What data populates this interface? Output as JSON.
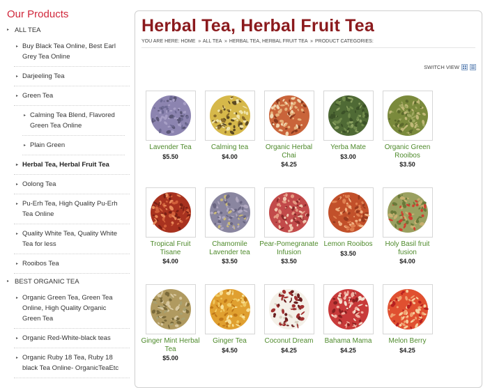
{
  "sidebar": {
    "title": "Our Products",
    "categories": [
      {
        "label": "ALL TEA",
        "level": "top"
      },
      {
        "label": "Buy Black Tea Online, Best Earl Grey Tea Online",
        "level": "l1"
      },
      {
        "label": "Darjeeling Tea",
        "level": "l1"
      },
      {
        "label": "Green Tea",
        "level": "l1"
      },
      {
        "label": "Calming Tea Blend, Flavored Green Tea Online",
        "level": "l2"
      },
      {
        "label": "Plain Green",
        "level": "l2"
      },
      {
        "label": "Herbal Tea, Herbal Fruit Tea",
        "level": "l1",
        "active": true
      },
      {
        "label": "Oolong Tea",
        "level": "l1"
      },
      {
        "label": "Pu-Erh Tea, High Quality Pu-Erh Tea Online",
        "level": "l1"
      },
      {
        "label": "Quality White Tea, Quality White Tea for less",
        "level": "l1"
      },
      {
        "label": "Rooibos Tea",
        "level": "l1"
      },
      {
        "label": "BEST ORGANIC TEA",
        "level": "top"
      },
      {
        "label": "Organic Green Tea, Green Tea Online, High Quality Organic Green Tea",
        "level": "l1"
      },
      {
        "label": "Organic Red-White-black teas",
        "level": "l1"
      },
      {
        "label": "Organic Ruby 18 Tea, Ruby 18 black Tea Online- OrganicTeaEtc",
        "level": "l1"
      }
    ]
  },
  "main": {
    "title": "Herbal Tea, Herbal Fruit Tea",
    "breadcrumb": {
      "prefix": "YOU ARE HERE:",
      "items": [
        "HOME",
        "ALL TEA",
        "HERBAL TEA, HERBAL FRUIT TEA",
        "PRODUCT CATEGORIES:"
      ],
      "separator": "»"
    },
    "switch_view_label": "SWITCH VIEW"
  },
  "products": [
    {
      "name": "Lavender Tea",
      "price": "$5.50",
      "palette": [
        "#8c84b0",
        "#6e6a94",
        "#a79fc6",
        "#5b5777"
      ]
    },
    {
      "name": "Calming tea",
      "price": "$4.00",
      "palette": [
        "#d6b84a",
        "#8a6b2a",
        "#efe3a8",
        "#5c4a22"
      ]
    },
    {
      "name": "Organic Herbal Chai",
      "price": "$4.25",
      "palette": [
        "#c9643a",
        "#e6b07a",
        "#8a3a1e",
        "#f0d6b0"
      ]
    },
    {
      "name": "Yerba Mate",
      "price": "$3.00",
      "palette": [
        "#4f6a35",
        "#6f8a4a",
        "#3c5228",
        "#8aa060"
      ]
    },
    {
      "name": "Organic Green Rooibos",
      "price": "$3.50",
      "palette": [
        "#7a8a3c",
        "#a0a860",
        "#5c6a2c",
        "#c0b878"
      ]
    },
    {
      "name": "Tropical Fruit Tisane",
      "price": "$4.00",
      "palette": [
        "#a8321f",
        "#d2603a",
        "#7a2014",
        "#e88a5a"
      ]
    },
    {
      "name": "Chamomile Lavender tea",
      "price": "$3.50",
      "palette": [
        "#8a86a0",
        "#c8b878",
        "#6a6682",
        "#b0a8c0"
      ]
    },
    {
      "name": "Pear-Pomegranate Infusion",
      "price": "$3.50",
      "palette": [
        "#c24a4a",
        "#e49a82",
        "#8a2a2a",
        "#f0c8b0"
      ]
    },
    {
      "name": "Lemon Rooibos",
      "price": "$3.50",
      "palette": [
        "#c2502a",
        "#e08050",
        "#9a3a1e",
        "#f0b080"
      ]
    },
    {
      "name": "Holy Basil fruit fusion",
      "price": "$4.00",
      "palette": [
        "#9aa060",
        "#d04030",
        "#c8b070",
        "#6a7a3a"
      ]
    },
    {
      "name": "Ginger Mint Herbal Tea",
      "price": "$5.00",
      "palette": [
        "#b09a60",
        "#d8c8a0",
        "#7a6a3a",
        "#a8a070"
      ]
    },
    {
      "name": "Ginger Tea",
      "price": "$4.50",
      "palette": [
        "#e0a030",
        "#f0c860",
        "#c07818",
        "#f8e098"
      ]
    },
    {
      "name": "Coconut Dream",
      "price": "$4.25",
      "palette": [
        "#f4f0e8",
        "#6a1e1e",
        "#a03030",
        "#d8d0c0"
      ]
    },
    {
      "name": "Bahama Mama",
      "price": "$4.25",
      "palette": [
        "#c83a3a",
        "#f0b0a0",
        "#8a2020",
        "#f4e0d0"
      ]
    },
    {
      "name": "Melon Berry",
      "price": "$4.25",
      "palette": [
        "#e05030",
        "#f0a070",
        "#b82020",
        "#f6d0a0"
      ]
    }
  ]
}
